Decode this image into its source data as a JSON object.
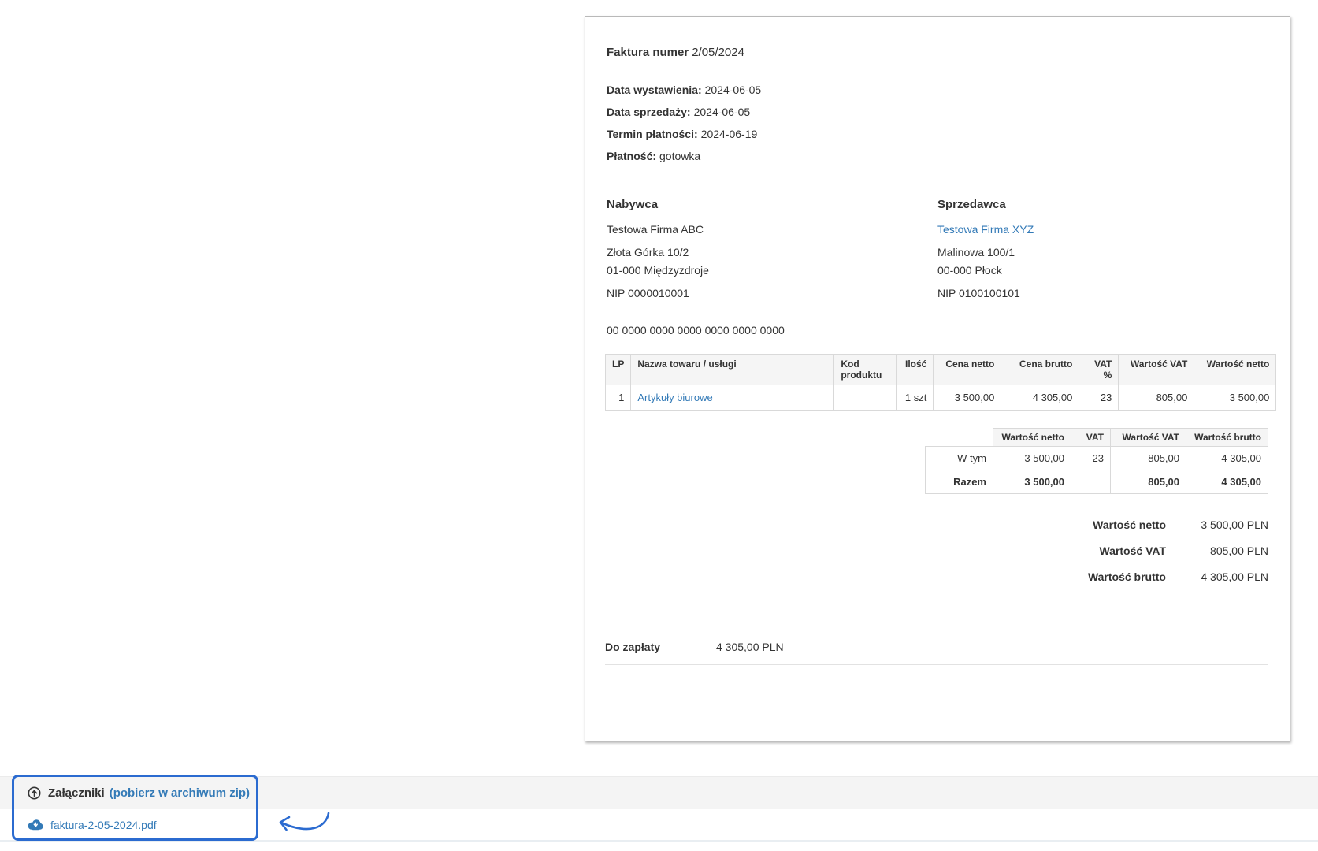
{
  "invoice": {
    "title_label": "Faktura numer",
    "title_number": "2/05/2024",
    "meta": [
      {
        "label": "Data wystawienia:",
        "value": "2024-06-05"
      },
      {
        "label": "Data sprzedaży:",
        "value": "2024-06-05"
      },
      {
        "label": "Termin płatności:",
        "value": "2024-06-19"
      },
      {
        "label": "Płatność:",
        "value": "gotowka"
      }
    ],
    "buyer": {
      "heading": "Nabywca",
      "name": "Testowa Firma ABC",
      "address_line1": "Złota Górka 10/2",
      "address_line2": "01-000 Międzyzdroje",
      "nip": "NIP 0000010001"
    },
    "seller": {
      "heading": "Sprzedawca",
      "name": "Testowa Firma XYZ",
      "address_line1": "Malinowa 100/1",
      "address_line2": "00-000 Płock",
      "nip": "NIP 0100100101"
    },
    "bank_account": "00 0000 0000 0000 0000 0000 0000",
    "items_table": {
      "headers": [
        "LP",
        "Nazwa towaru / usługi",
        "Kod produktu",
        "Ilość",
        "Cena netto",
        "Cena brutto",
        "VAT %",
        "Wartość VAT",
        "Wartość netto"
      ],
      "rows": [
        {
          "lp": "1",
          "name": "Artykuły biurowe",
          "code": "",
          "qty": "1 szt",
          "net_price": "3 500,00",
          "gross_price": "4 305,00",
          "vat_rate": "23",
          "vat_value": "805,00",
          "net_value": "3 500,00"
        }
      ]
    },
    "vat_summary": {
      "headers": [
        "Wartość netto",
        "VAT",
        "Wartość VAT",
        "Wartość brutto"
      ],
      "rows": [
        {
          "label": "W tym",
          "net": "3 500,00",
          "vat_rate": "23",
          "vat": "805,00",
          "gross": "4 305,00"
        },
        {
          "label": "Razem",
          "net": "3 500,00",
          "vat_rate": "",
          "vat": "805,00",
          "gross": "4 305,00"
        }
      ]
    },
    "totals": [
      {
        "label": "Wartość netto",
        "value": "3 500,00 PLN"
      },
      {
        "label": "Wartość VAT",
        "value": "805,00 PLN"
      },
      {
        "label": "Wartość brutto",
        "value": "4 305,00 PLN"
      }
    ],
    "due": {
      "label": "Do zapłaty",
      "value": "4 305,00 PLN"
    }
  },
  "attachments": {
    "heading": "Załączniki",
    "zip_link": "(pobierz w archiwum zip)",
    "files": [
      {
        "name": "faktura-2-05-2024.pdf"
      }
    ]
  },
  "icons": {
    "header_icon": "circle-arrow-up-icon",
    "file_icon": "cloud-download-icon",
    "annotation": "hand-drawn-curved-arrow"
  },
  "colors": {
    "link": "#337ab7",
    "highlight": "#2b6bd0",
    "text": "#333333",
    "table_header_bg": "#f5f5f5",
    "footer_strip_bg": "#f4f4f4"
  }
}
